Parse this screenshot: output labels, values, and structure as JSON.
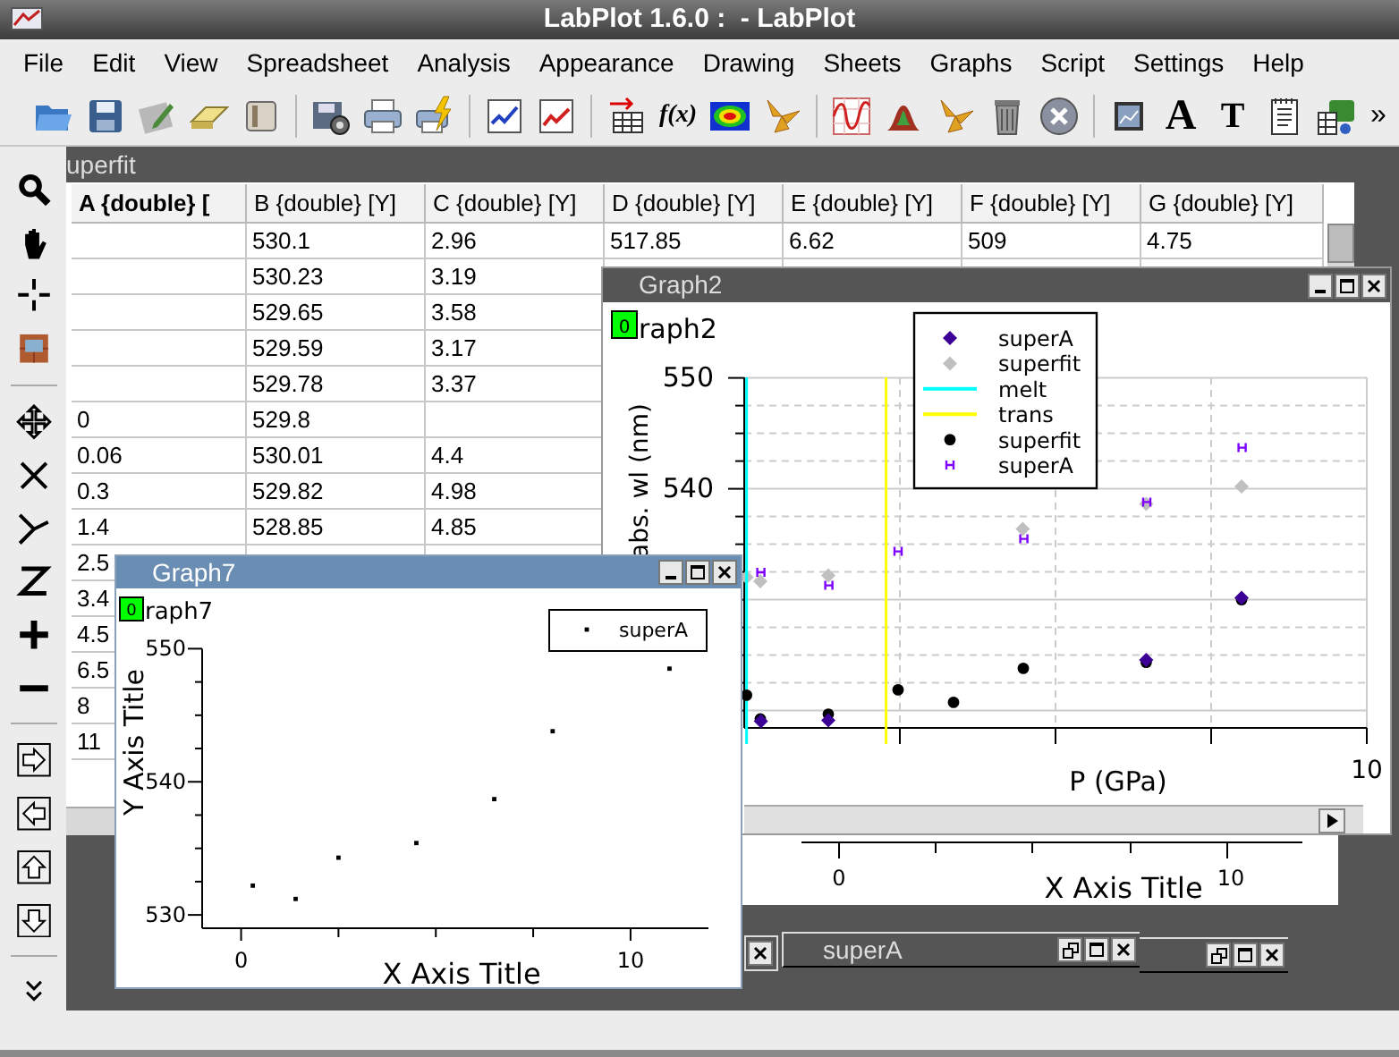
{
  "window": {
    "title": "LabPlot 1.6.0 :  - LabPlot"
  },
  "menu": [
    "File",
    "Edit",
    "View",
    "Spreadsheet",
    "Analysis",
    "Appearance",
    "Drawing",
    "Sheets",
    "Graphs",
    "Script",
    "Settings",
    "Help"
  ],
  "toolbar": {
    "glyphs": [
      "f(x)",
      "A",
      "T"
    ],
    "overflow": "»"
  },
  "spreadsheet": {
    "title": "uperfit",
    "active": false,
    "columns": [
      {
        "label": "A {double} [",
        "selected": true
      },
      {
        "label": "B {double} [Y]",
        "selected": false
      },
      {
        "label": "C {double} [Y]",
        "selected": false
      },
      {
        "label": "D {double} [Y]",
        "selected": false
      },
      {
        "label": "E {double} [Y]",
        "selected": false
      },
      {
        "label": "F {double} [Y]",
        "selected": false
      },
      {
        "label": "G {double} [Y]",
        "selected": false
      }
    ],
    "rows": [
      [
        null,
        "530.1",
        "2.96",
        "517.85",
        "6.62",
        "509",
        "4.75"
      ],
      [
        null,
        "530.23",
        "3.19"
      ],
      [
        null,
        "529.65",
        "3.58"
      ],
      [
        null,
        "529.59",
        "3.17"
      ],
      [
        null,
        "529.78",
        "3.37"
      ],
      [
        "0",
        "529.8",
        null
      ],
      [
        "0.06",
        "530.01",
        "4.4"
      ],
      [
        "0.3",
        "529.82",
        "4.98"
      ],
      [
        "1.4",
        "528.85",
        "4.85"
      ],
      [
        "2.5"
      ],
      [
        "3.4"
      ],
      [
        "4.5"
      ],
      [
        "6.5"
      ],
      [
        "8"
      ],
      [
        "11"
      ]
    ]
  },
  "graph2": {
    "title": "Graph2",
    "active": false,
    "badge": "0",
    "label": "raph2",
    "xlabel": "P (GPa)",
    "ylabel": "abs. wl (nm)",
    "y_tick_labels": [
      "550",
      "540"
    ],
    "x_tick_labels": [
      "10"
    ],
    "legend": [
      {
        "label": "superA",
        "kind": "diamond",
        "color": "#3c0096"
      },
      {
        "label": "superfit",
        "kind": "diamond",
        "color": "#c0c0c0"
      },
      {
        "label": "melt",
        "kind": "line",
        "color": "#00ffff"
      },
      {
        "label": "trans",
        "kind": "line",
        "color": "#ffff00"
      },
      {
        "label": "superfit",
        "kind": "dot",
        "color": "#000000"
      },
      {
        "label": "superA",
        "kind": "errorbar",
        "color": "#7f00ff"
      }
    ]
  },
  "graph7": {
    "title": "Graph7",
    "active": true,
    "badge": "0",
    "label": "raph7",
    "chart_data": {
      "type": "scatter",
      "xlabel": "X Axis Title",
      "ylabel": "Y Axis Title",
      "x": [
        0.3,
        1.4,
        2.5,
        4.5,
        6.5,
        8,
        11
      ],
      "xlim": [
        -1,
        12
      ],
      "ylim": [
        529,
        550
      ],
      "xticks": [
        0,
        10
      ],
      "yticks": [
        530,
        540,
        550
      ],
      "series": [
        {
          "name": "superA",
          "color": "#000000",
          "values": [
            532.2,
            531.2,
            534.3,
            535.4,
            538.7,
            543.8,
            548.5
          ]
        }
      ]
    }
  },
  "back_graph": {
    "x_tick_labels": [
      "0",
      "10"
    ],
    "x_axis_title": "X Axis Title"
  },
  "minimized": [
    {
      "kind": "covered"
    },
    {
      "kind": "titled",
      "title": "superA"
    },
    {
      "kind": "untitled"
    }
  ]
}
